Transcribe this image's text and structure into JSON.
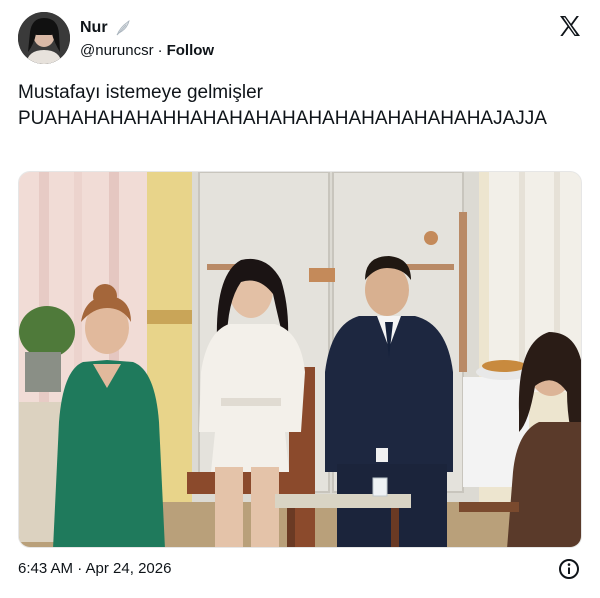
{
  "author": {
    "display_name": "Nur",
    "badge_icon": "feather-icon",
    "handle": "@nuruncsr",
    "separator": "·",
    "follow_label": "Follow"
  },
  "brand": {
    "logo_icon": "x-logo-icon"
  },
  "tweet": {
    "line1": "Mustafayı istemeye gelmişler",
    "line2": "PUAHAHAHAHAHHAHAHAHAHAHAHAHAHAHAHAHAJAJJA"
  },
  "media": {
    "kind": "photo"
  },
  "footer": {
    "timestamp": "6:43 AM · Apr 24, 2026",
    "info_icon": "info-icon"
  },
  "colors": {
    "text": "#0f1419",
    "background": "#ffffff",
    "border": "#e6e6e6"
  }
}
